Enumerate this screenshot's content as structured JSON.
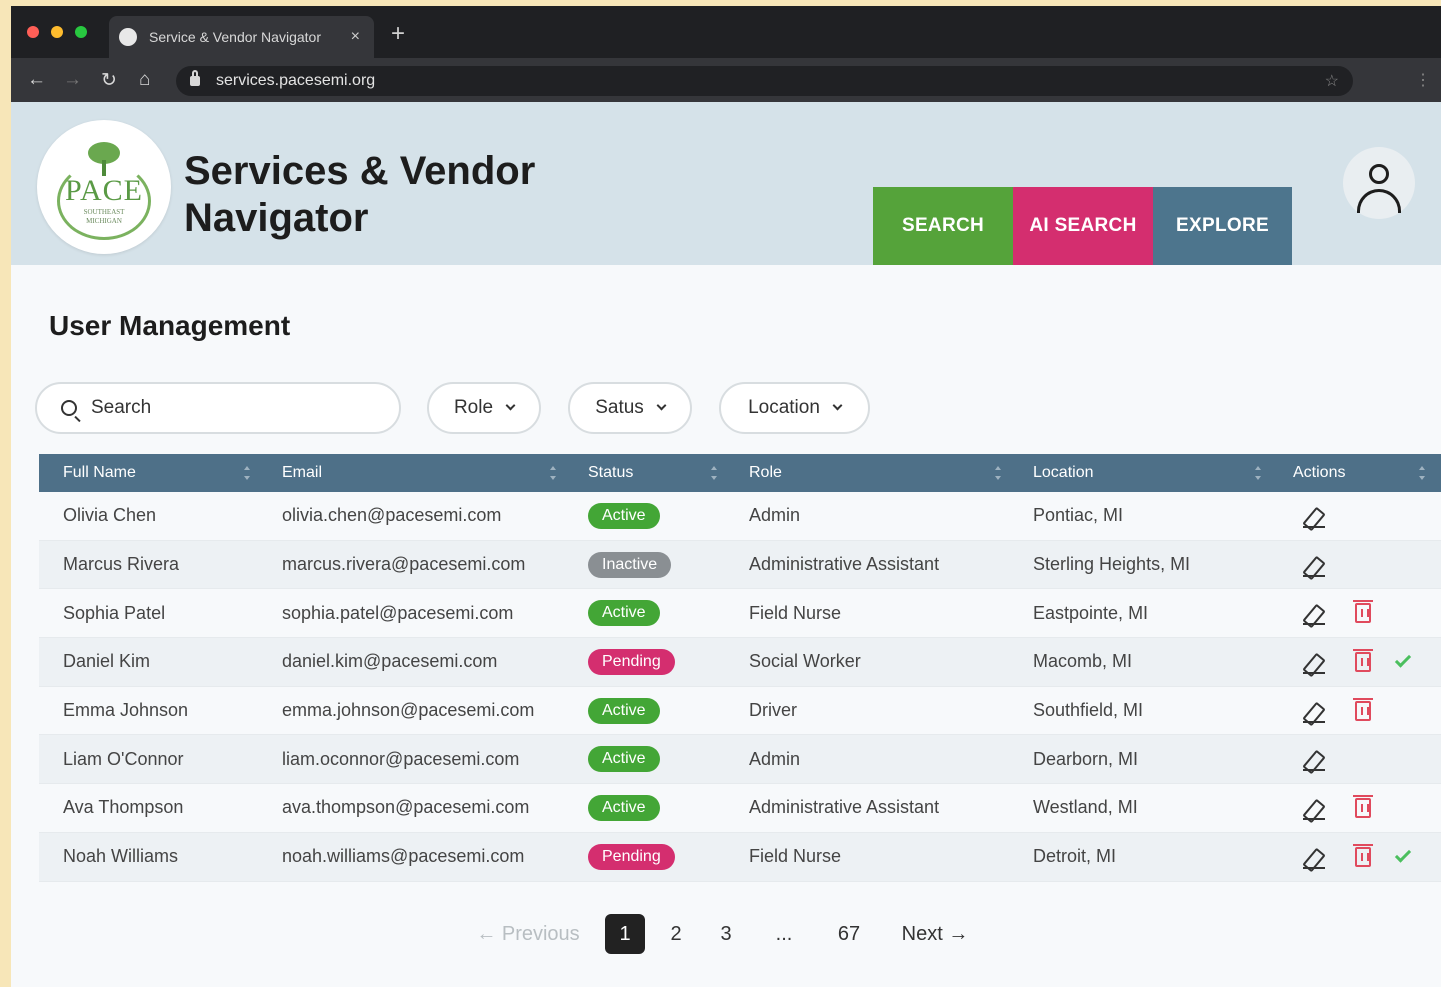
{
  "browser": {
    "tab_title": "Service & Vendor Navigator",
    "tab_close": "×",
    "new_tab": "+",
    "url": "services.pacesemi.org",
    "nav_icons": [
      "back-icon",
      "forward-icon",
      "reload-icon",
      "home-icon",
      "lock-icon",
      "star-icon",
      "kebab-menu-icon"
    ]
  },
  "header": {
    "logo_text": "PACE",
    "logo_sub": "SOUTHEAST MICHIGAN",
    "title_line1": "Services & Vendor",
    "title_line2": "Navigator",
    "nav": [
      {
        "label": "SEARCH",
        "color": "#55a33a"
      },
      {
        "label": "AI SEARCH",
        "color": "#d42e6f"
      },
      {
        "label": "EXPLORE",
        "color": "#4d758d"
      }
    ],
    "avatar_icon": "user-icon"
  },
  "page": {
    "title": "User Management",
    "search_placeholder": "Search",
    "filters": [
      "Role",
      "Satus",
      "Location"
    ]
  },
  "table": {
    "columns": [
      "Full Name",
      "Email",
      "Status",
      "Role",
      "Location",
      "Actions"
    ],
    "rows": [
      {
        "name": "Olivia Chen",
        "email": "olivia.chen@pacesemi.com",
        "status": "Active",
        "role": "Admin",
        "location": "Pontiac, MI",
        "actions": [
          "edit"
        ]
      },
      {
        "name": "Marcus Rivera",
        "email": "marcus.rivera@pacesemi.com",
        "status": "Inactive",
        "role": "Administrative Assistant",
        "location": "Sterling Heights, MI",
        "actions": [
          "edit"
        ]
      },
      {
        "name": "Sophia Patel",
        "email": "sophia.patel@pacesemi.com",
        "status": "Active",
        "role": "Field Nurse",
        "location": "Eastpointe, MI",
        "actions": [
          "edit",
          "delete"
        ]
      },
      {
        "name": "Daniel Kim",
        "email": "daniel.kim@pacesemi.com",
        "status": "Pending",
        "role": "Social Worker",
        "location": "Macomb, MI",
        "actions": [
          "edit",
          "delete",
          "approve"
        ]
      },
      {
        "name": "Emma Johnson",
        "email": "emma.johnson@pacesemi.com",
        "status": "Active",
        "role": "Driver",
        "location": "Southfield, MI",
        "actions": [
          "edit",
          "delete"
        ]
      },
      {
        "name": "Liam O'Connor",
        "email": "liam.oconnor@pacesemi.com",
        "status": "Active",
        "role": "Admin",
        "location": "Dearborn, MI",
        "actions": [
          "edit"
        ]
      },
      {
        "name": "Ava Thompson",
        "email": "ava.thompson@pacesemi.com",
        "status": "Active",
        "role": "Administrative Assistant",
        "location": "Westland, MI",
        "actions": [
          "edit",
          "delete"
        ]
      },
      {
        "name": "Noah Williams",
        "email": "noah.williams@pacesemi.com",
        "status": "Pending",
        "role": "Field Nurse",
        "location": "Detroit, MI",
        "actions": [
          "edit",
          "delete",
          "approve"
        ]
      }
    ],
    "status_colors": {
      "Active": "#43a636",
      "Inactive": "#8a8f93",
      "Pending": "#d42e6f"
    }
  },
  "pagination": {
    "previous": "← Previous",
    "pages": [
      "1",
      "2",
      "3",
      "...",
      "67"
    ],
    "current": "1",
    "next": "Next →"
  }
}
